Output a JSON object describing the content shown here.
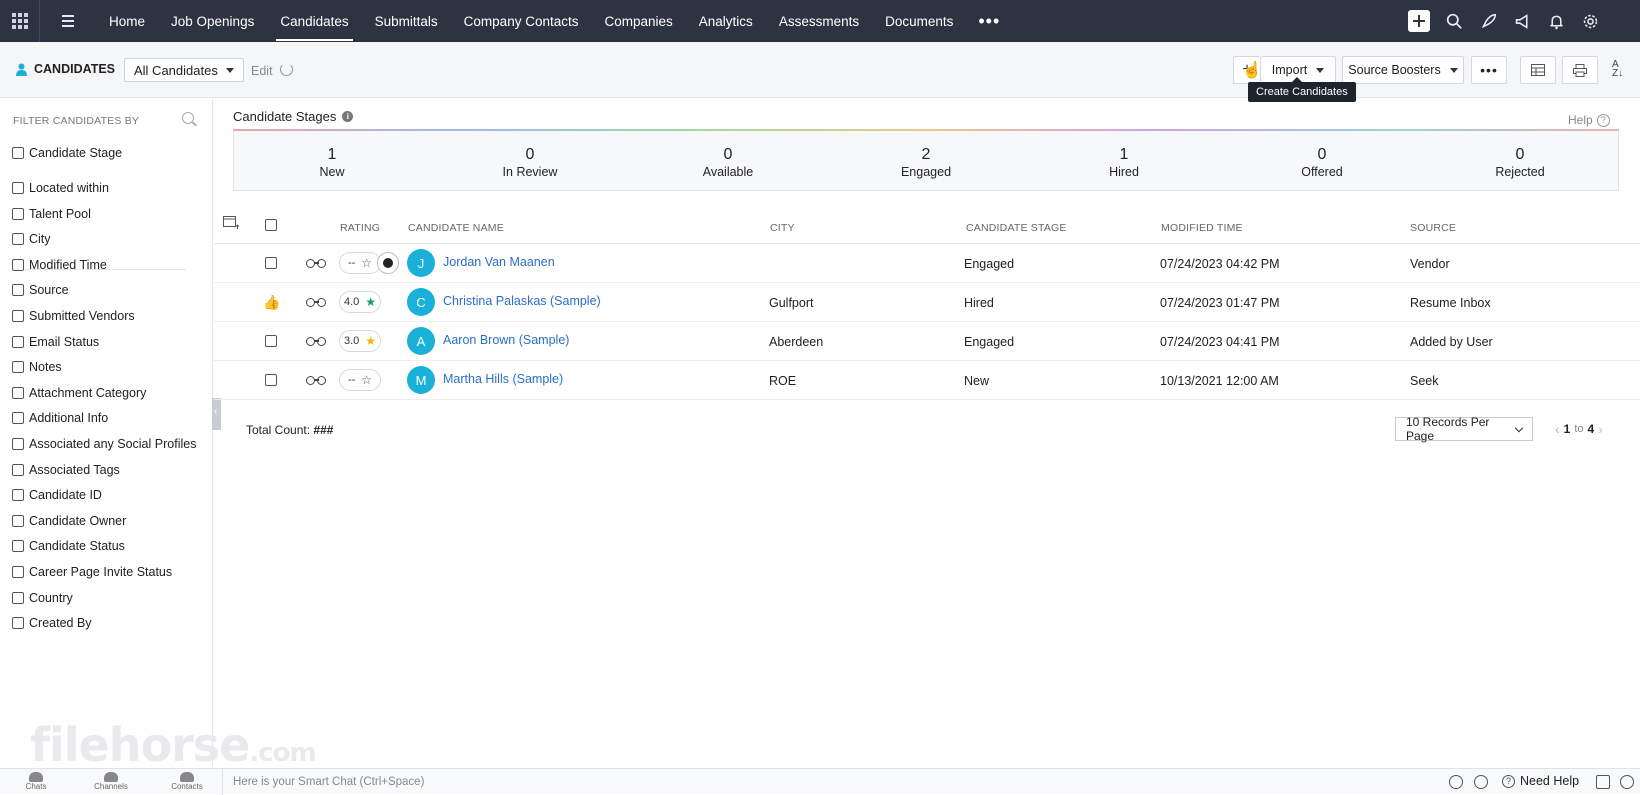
{
  "nav": {
    "items": [
      "Home",
      "Job Openings",
      "Candidates",
      "Submittals",
      "Company Contacts",
      "Companies",
      "Analytics",
      "Assessments",
      "Documents"
    ],
    "active": "Candidates",
    "more": "•••"
  },
  "subbar": {
    "module": "CANDIDATES",
    "view": "All Candidates",
    "edit": "Edit",
    "import": "Import",
    "source_boosters": "Source Boosters",
    "tooltip": "Create Candidates"
  },
  "sidebar": {
    "heading": "FILTER CANDIDATES BY",
    "first": "Candidate Stage",
    "filters": [
      "Located within",
      "Talent Pool",
      "City",
      "Modified Time",
      "Source",
      "Submitted Vendors",
      "Email Status",
      "Notes",
      "Attachment Category",
      "Additional Info",
      "Associated any Social Profiles",
      "Associated Tags",
      "Candidate ID",
      "Candidate Owner",
      "Candidate Status",
      "Career Page Invite Status",
      "Country",
      "Created By"
    ]
  },
  "stages": {
    "title": "Candidate Stages",
    "help": "Help",
    "items": [
      {
        "count": "1",
        "label": "New"
      },
      {
        "count": "0",
        "label": "In Review"
      },
      {
        "count": "0",
        "label": "Available"
      },
      {
        "count": "2",
        "label": "Engaged"
      },
      {
        "count": "1",
        "label": "Hired"
      },
      {
        "count": "0",
        "label": "Offered"
      },
      {
        "count": "0",
        "label": "Rejected"
      }
    ]
  },
  "table": {
    "headers": {
      "rating": "RATING",
      "name": "CANDIDATE NAME",
      "city": "CITY",
      "stage": "CANDIDATE STAGE",
      "modified": "MODIFIED TIME",
      "source": "SOURCE"
    },
    "rows": [
      {
        "initial": "J",
        "name": "Jordan Van Maanen",
        "city": "",
        "stage": "Engaged",
        "modified": "07/24/2023 04:42 PM",
        "source": "Vendor",
        "rating": "--"
      },
      {
        "initial": "C",
        "name": "Christina Palaskas (Sample)",
        "city": "Gulfport",
        "stage": "Hired",
        "modified": "07/24/2023 01:47 PM",
        "source": "Resume Inbox",
        "rating": "4.0"
      },
      {
        "initial": "A",
        "name": "Aaron Brown (Sample)",
        "city": "Aberdeen",
        "stage": "Engaged",
        "modified": "07/24/2023 04:41 PM",
        "source": "Added by User",
        "rating": "3.0"
      },
      {
        "initial": "M",
        "name": "Martha Hills (Sample)",
        "city": "ROE",
        "stage": "New",
        "modified": "10/13/2021 12:00 AM",
        "source": "Seek",
        "rating": "--"
      }
    ]
  },
  "footer": {
    "total_label": "Total Count:",
    "total_value": "###",
    "per_page": "10 Records Per Page",
    "page_from": "1",
    "page_to_word": "to",
    "page_to": "4"
  },
  "watermark": {
    "main": "filehorse",
    "suffix": ".com"
  },
  "bottom": {
    "chats": "Chats",
    "channels": "Channels",
    "contacts": "Contacts",
    "smartchat": "Here is your Smart Chat (Ctrl+Space)",
    "needhelp": "Need Help"
  },
  "colors": {
    "topnav": "#2c3441",
    "avatar": "#1ab0d8",
    "link": "#2a6fc9"
  }
}
